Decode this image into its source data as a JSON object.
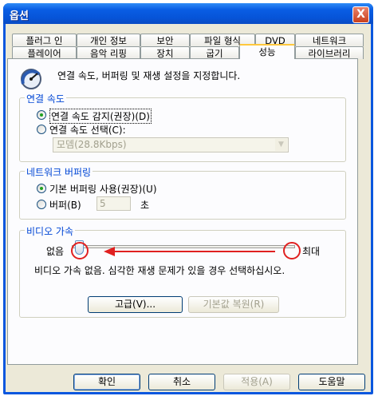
{
  "window": {
    "title": "옵션",
    "close_label": "X"
  },
  "tabs_row1": [
    "플러그 인",
    "개인 정보",
    "보안",
    "파일 형식",
    "DVD",
    "네트워크"
  ],
  "tabs_row2": [
    "플레이어",
    "음악 리핑",
    "장치",
    "굽기",
    "성능",
    "라이브러리"
  ],
  "active_tab": "성능",
  "header_text": "연결 속도, 버퍼링 및 재생 설정을 지정합니다.",
  "connection": {
    "group_label": "연결 속도",
    "detect_label": "연결 속도 감지(권장)(D)",
    "choose_label": "연결 속도 선택(C):",
    "speed_value": "모뎀(28.8Kbps)"
  },
  "buffering": {
    "group_label": "네트워크 버퍼링",
    "default_label": "기본 버퍼링 사용(권장)(U)",
    "buffer_label": "버퍼(B)",
    "buffer_value": "5",
    "unit_label": "초"
  },
  "video": {
    "group_label": "비디오 가속",
    "min_label": "없음",
    "max_label": "최대",
    "slider_level": 0,
    "description": "비디오 가속 없음. 심각한 재생 문제가 있을 경우 선택하십시오.",
    "advanced_label": "고급(V)...",
    "restore_label": "기본값 복원(R)"
  },
  "footer": {
    "ok_label": "확인",
    "cancel_label": "취소",
    "apply_label": "적용(A)",
    "help_label": "도움말"
  },
  "colors": {
    "title_blue": "#0a57de",
    "group_label_blue": "#0046d5",
    "annotation_red": "#e02020",
    "radio_green": "#21a121"
  }
}
